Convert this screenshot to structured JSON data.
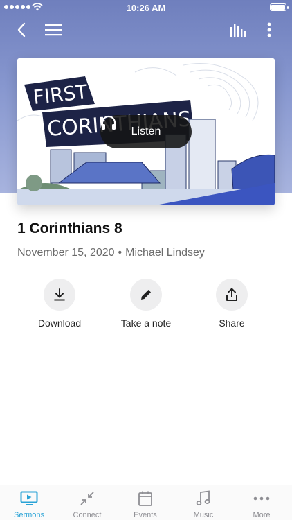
{
  "status_bar": {
    "time": "10:26 AM"
  },
  "artwork": {
    "title_line1": "FIRST",
    "title_line2": "CORINTHIANS"
  },
  "listen": {
    "label": "Listen"
  },
  "sermon": {
    "title": "1 Corinthians 8",
    "date": "November 15, 2020",
    "separator": "•",
    "speaker": "Michael Lindsey"
  },
  "actions": [
    {
      "label": "Download",
      "icon": "download-icon"
    },
    {
      "label": "Take a note",
      "icon": "pencil-icon"
    },
    {
      "label": "Share",
      "icon": "share-icon"
    }
  ],
  "tabs": [
    {
      "label": "Sermons",
      "icon": "tv-icon",
      "active": true
    },
    {
      "label": "Connect",
      "icon": "connect-icon",
      "active": false
    },
    {
      "label": "Events",
      "icon": "calendar-icon",
      "active": false
    },
    {
      "label": "Music",
      "icon": "music-icon",
      "active": false
    },
    {
      "label": "More",
      "icon": "more-dots-icon",
      "active": false
    }
  ],
  "colors": {
    "accent": "#2aa3d6",
    "header": "#7b8bc6"
  }
}
